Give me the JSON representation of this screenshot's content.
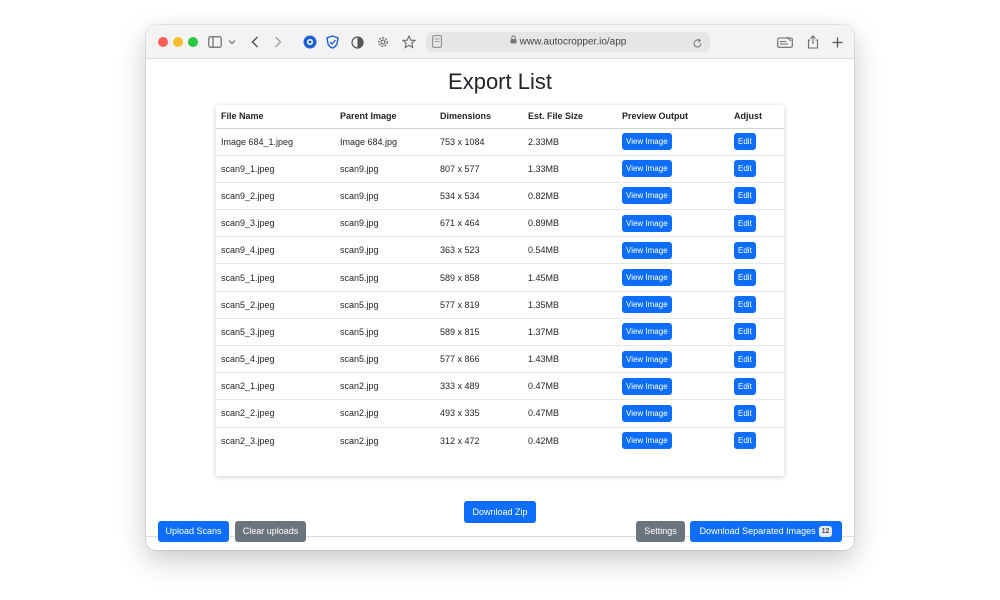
{
  "browser": {
    "url": "www.autocropper.io/app"
  },
  "page": {
    "title": "Export List"
  },
  "table": {
    "headers": [
      "File Name",
      "Parent Image",
      "Dimensions",
      "Est. File Size",
      "Preview Output",
      "Adjust"
    ],
    "rows": [
      {
        "file": "Image 684_1.jpeg",
        "parent": "Image 684.jpg",
        "dims": "753 x 1084",
        "size": "2.33MB"
      },
      {
        "file": "scan9_1.jpeg",
        "parent": "scan9.jpg",
        "dims": "807 x 577",
        "size": "1.33MB"
      },
      {
        "file": "scan9_2.jpeg",
        "parent": "scan9.jpg",
        "dims": "534 x 534",
        "size": "0.82MB"
      },
      {
        "file": "scan9_3.jpeg",
        "parent": "scan9.jpg",
        "dims": "671 x 464",
        "size": "0.89MB"
      },
      {
        "file": "scan9_4.jpeg",
        "parent": "scan9.jpg",
        "dims": "363 x 523",
        "size": "0.54MB"
      },
      {
        "file": "scan5_1.jpeg",
        "parent": "scan5.jpg",
        "dims": "589 x 858",
        "size": "1.45MB"
      },
      {
        "file": "scan5_2.jpeg",
        "parent": "scan5.jpg",
        "dims": "577 x 819",
        "size": "1.35MB"
      },
      {
        "file": "scan5_3.jpeg",
        "parent": "scan5.jpg",
        "dims": "589 x 815",
        "size": "1.37MB"
      },
      {
        "file": "scan5_4.jpeg",
        "parent": "scan5.jpg",
        "dims": "577 x 866",
        "size": "1.43MB"
      },
      {
        "file": "scan2_1.jpeg",
        "parent": "scan2.jpg",
        "dims": "333 x 489",
        "size": "0.47MB"
      },
      {
        "file": "scan2_2.jpeg",
        "parent": "scan2.jpg",
        "dims": "493 x 335",
        "size": "0.47MB"
      },
      {
        "file": "scan2_3.jpeg",
        "parent": "scan2.jpg",
        "dims": "312 x 472",
        "size": "0.42MB"
      }
    ],
    "view_label": "View Image",
    "edit_label": "Edit"
  },
  "actions": {
    "download_zip": "Download Zip",
    "upload_scans": "Upload Scans",
    "clear_uploads": "Clear uploads",
    "settings": "Settings",
    "download_separated": "Download Separated Images",
    "separated_count": "12"
  },
  "colors": {
    "primary": "#0d6efd",
    "secondary": "#6c757d"
  },
  "icons": [
    "sidebar-icon",
    "chevron-down-icon",
    "back-icon",
    "forward-icon",
    "privacy-icon",
    "shield-icon",
    "contrast-icon",
    "gear-icon",
    "star-icon",
    "page-icon",
    "lock-icon",
    "reload-icon",
    "reader-icon",
    "share-icon",
    "plus-icon"
  ]
}
